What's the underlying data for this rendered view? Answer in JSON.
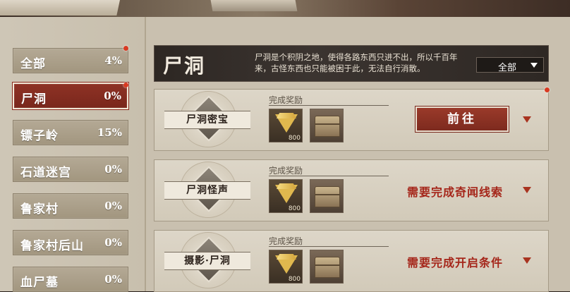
{
  "sidebar": {
    "items": [
      {
        "label": "全部",
        "pct": "4%"
      },
      {
        "label": "尸洞",
        "pct": "0%"
      },
      {
        "label": "镖子岭",
        "pct": "15%"
      },
      {
        "label": "石道迷宫",
        "pct": "0%"
      },
      {
        "label": "鲁家村",
        "pct": "0%"
      },
      {
        "label": "鲁家村后山",
        "pct": "0%"
      },
      {
        "label": "血尸墓",
        "pct": "0%"
      }
    ]
  },
  "header": {
    "title": "尸洞",
    "description": "尸洞是个积阴之地，使得各路东西只进不出，所以千百年来，古怪东西也只能被困于此，无法自行消散。",
    "filter": "全部"
  },
  "quests": [
    {
      "name": "尸洞密宝",
      "reward_label": "完成奖励",
      "gem_qty": "800",
      "action": "前往"
    },
    {
      "name": "尸洞怪声",
      "reward_label": "完成奖励",
      "gem_qty": "800",
      "requirement": "需要完成奇闻线索"
    },
    {
      "name": "摄影·尸洞",
      "reward_label": "完成奖励",
      "gem_qty": "800",
      "requirement": "需要完成开启条件"
    }
  ],
  "colors": {
    "accent_red": "#8e3225",
    "requirement_text": "#a5261a",
    "notify_dot": "#d83a22"
  }
}
